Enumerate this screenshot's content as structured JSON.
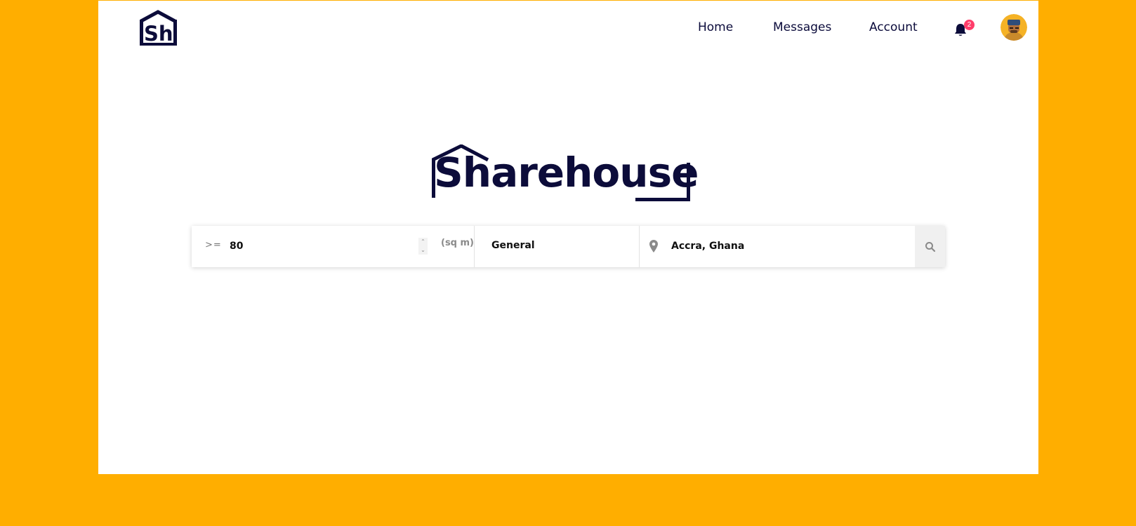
{
  "header": {
    "logo_text": "Sh",
    "nav": {
      "home": "Home",
      "messages": "Messages",
      "account": "Account"
    },
    "notifications": {
      "icon": "bell-icon",
      "count": "2"
    },
    "avatar": "user-avatar"
  },
  "main": {
    "logo_text": "Sharehouse"
  },
  "search": {
    "size_operator": ">=",
    "size_value": "80",
    "size_unit": "(sq m)",
    "type_value": "General",
    "location_icon": "map-pin-icon",
    "location_value": "Accra, Ghana",
    "search_icon": "search-icon"
  },
  "colors": {
    "background": "#FFAE00",
    "brand": "#0C0C3A",
    "badge": "#FF3D6A"
  }
}
